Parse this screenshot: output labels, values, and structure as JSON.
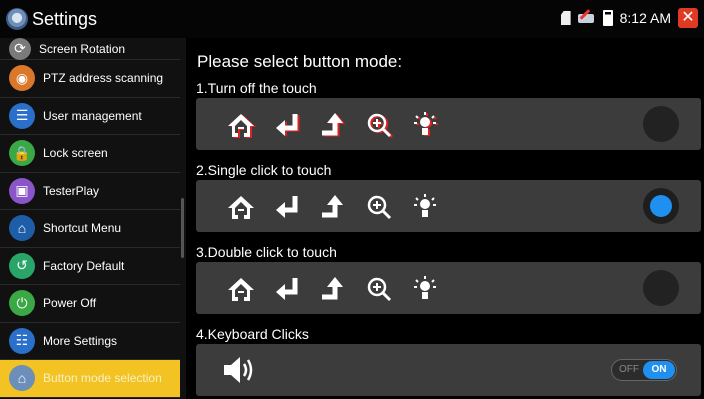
{
  "window": {
    "title": "Settings"
  },
  "status": {
    "time": "8:12 AM"
  },
  "sidebar": {
    "items": [
      {
        "label": "Screen Rotation",
        "icon": "rotation-icon",
        "color": "#7a7a7a"
      },
      {
        "label": "PTZ address scanning",
        "icon": "ptz-icon",
        "color": "#d9772a"
      },
      {
        "label": "User management",
        "icon": "user-icon",
        "color": "#2a6fc9"
      },
      {
        "label": "Lock screen",
        "icon": "lock-icon",
        "color": "#3aa845"
      },
      {
        "label": "TesterPlay",
        "icon": "testerplay-icon",
        "color": "#8a55c9"
      },
      {
        "label": "Shortcut Menu",
        "icon": "shortcut-icon",
        "color": "#1e5ea8"
      },
      {
        "label": "Factory Default",
        "icon": "factory-default-icon",
        "color": "#2aa56a"
      },
      {
        "label": "Power Off",
        "icon": "power-icon",
        "color": "#3aa845"
      },
      {
        "label": "More Settings",
        "icon": "more-settings-icon",
        "color": "#2a6fc9"
      },
      {
        "label": "Button mode selection",
        "icon": "button-mode-icon",
        "color": "#6b8fb8",
        "active": true
      }
    ]
  },
  "main": {
    "heading": "Please select button mode:",
    "sections": [
      {
        "label": "1.Turn off the touch",
        "selected": false,
        "style": "red"
      },
      {
        "label": "2.Single click to touch",
        "selected": true,
        "style": "white"
      },
      {
        "label": "3.Double click to touch",
        "selected": false,
        "style": "white"
      }
    ],
    "keyboard": {
      "label": "4.Keyboard Clicks",
      "off_label": "OFF",
      "on_label": "ON",
      "state": "on"
    },
    "icons": [
      "home-icon",
      "back-icon",
      "return-icon",
      "zoom-in-icon",
      "brightness-icon"
    ]
  },
  "colors": {
    "accent": "#f2c322",
    "toggle_on": "#1f8ff0",
    "close": "#e03a25"
  }
}
